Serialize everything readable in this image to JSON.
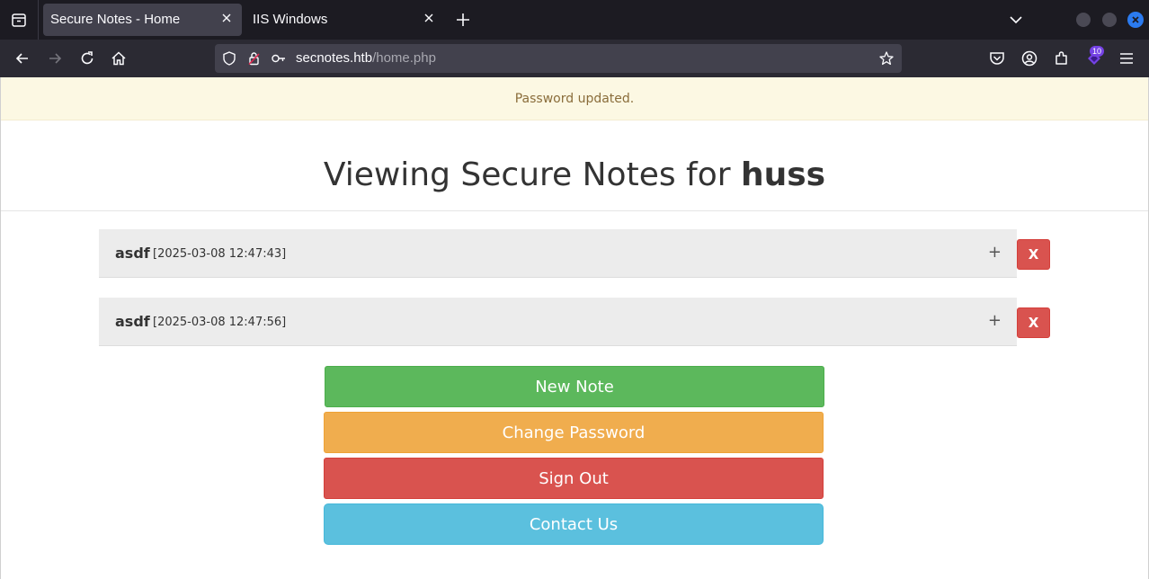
{
  "browser": {
    "tabs": [
      {
        "title": "Secure Notes - Home",
        "active": true
      },
      {
        "title": "IIS Windows",
        "active": false
      }
    ],
    "url": {
      "host": "secnotes.htb",
      "path": "/home.php"
    },
    "extension_badge": "10",
    "colors": {
      "accent": "#2b7bf0",
      "extension": "#7542e5"
    }
  },
  "alert": {
    "message": "Password updated."
  },
  "heading": {
    "prefix": "Viewing Secure Notes for",
    "username": "huss"
  },
  "notes": [
    {
      "title": "asdf",
      "timestamp": "[2025-03-08 12:47:43]",
      "expand": "+",
      "delete": "X"
    },
    {
      "title": "asdf",
      "timestamp": "[2025-03-08 12:47:56]",
      "expand": "+",
      "delete": "X"
    }
  ],
  "actions": {
    "new_note": "New Note",
    "change_password": "Change Password",
    "sign_out": "Sign Out",
    "contact_us": "Contact Us"
  },
  "colors": {
    "success": "#5cb85c",
    "warning": "#f0ad4e",
    "danger": "#d9534f",
    "info": "#5bc0de",
    "alert_bg": "#fcf8e3"
  }
}
